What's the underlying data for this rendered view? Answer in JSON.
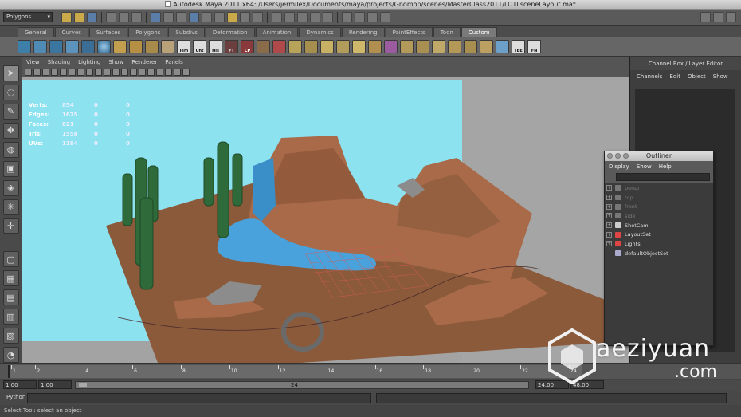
{
  "window": {
    "title": "Autodesk Maya 2011 x64: /Users/jermilex/Documents/maya/projects/Gnomon/scenes/MasterClass2011/LOTLsceneLayout.ma*"
  },
  "status_line": {
    "menu_set": "Polygons"
  },
  "shelf": {
    "tabs": [
      "General",
      "Curves",
      "Surfaces",
      "Polygons",
      "Subdivs",
      "Deformation",
      "Animation",
      "Dynamics",
      "Rendering",
      "PaintEffects",
      "Toon",
      "Custom"
    ],
    "active_tab": "Custom",
    "labels": [
      "Tem",
      "Unt",
      "His",
      "FT",
      "CP",
      "TBE",
      "FN"
    ]
  },
  "panel": {
    "menus": [
      "View",
      "Shading",
      "Lighting",
      "Show",
      "Renderer",
      "Panels"
    ],
    "hud": [
      {
        "label": "Verts:",
        "values": [
          "854",
          "0",
          "0"
        ]
      },
      {
        "label": "Edges:",
        "values": [
          "1675",
          "0",
          "0"
        ]
      },
      {
        "label": "Faces:",
        "values": [
          "821",
          "0",
          "0"
        ]
      },
      {
        "label": "Tris:",
        "values": [
          "1558",
          "0",
          "0"
        ]
      },
      {
        "label": "UVs:",
        "values": [
          "1184",
          "0",
          "0"
        ]
      }
    ]
  },
  "channel_box": {
    "title": "Channel Box / Layer Editor",
    "menus": [
      "Channels",
      "Edit",
      "Object",
      "Show"
    ]
  },
  "outliner": {
    "title": "Outliner",
    "menus": [
      "Display",
      "Show",
      "Help"
    ],
    "items": [
      {
        "label": "persp",
        "dim": true
      },
      {
        "label": "top",
        "dim": true
      },
      {
        "label": "front",
        "dim": true
      },
      {
        "label": "side",
        "dim": true
      },
      {
        "label": "ShotCam",
        "dim": false
      },
      {
        "label": "LayoutSet",
        "dim": false
      },
      {
        "label": "Lights",
        "dim": false
      },
      {
        "label": "defaultObjectSet",
        "dim": false
      }
    ]
  },
  "time_slider": {
    "ticks": [
      "1",
      "2",
      "4",
      "6",
      "8",
      "10",
      "12",
      "14",
      "16",
      "18",
      "20",
      "22",
      "24"
    ]
  },
  "range_slider": {
    "start": "1.00",
    "range_start": "1.00",
    "range_mid": "24",
    "range_end": "24.00",
    "end": "48.00"
  },
  "command_line": {
    "label": "Python"
  },
  "help_line": {
    "text": "Select Tool: select an object"
  },
  "watermark": {
    "text": "aeziyuan",
    "suffix": ".com"
  }
}
